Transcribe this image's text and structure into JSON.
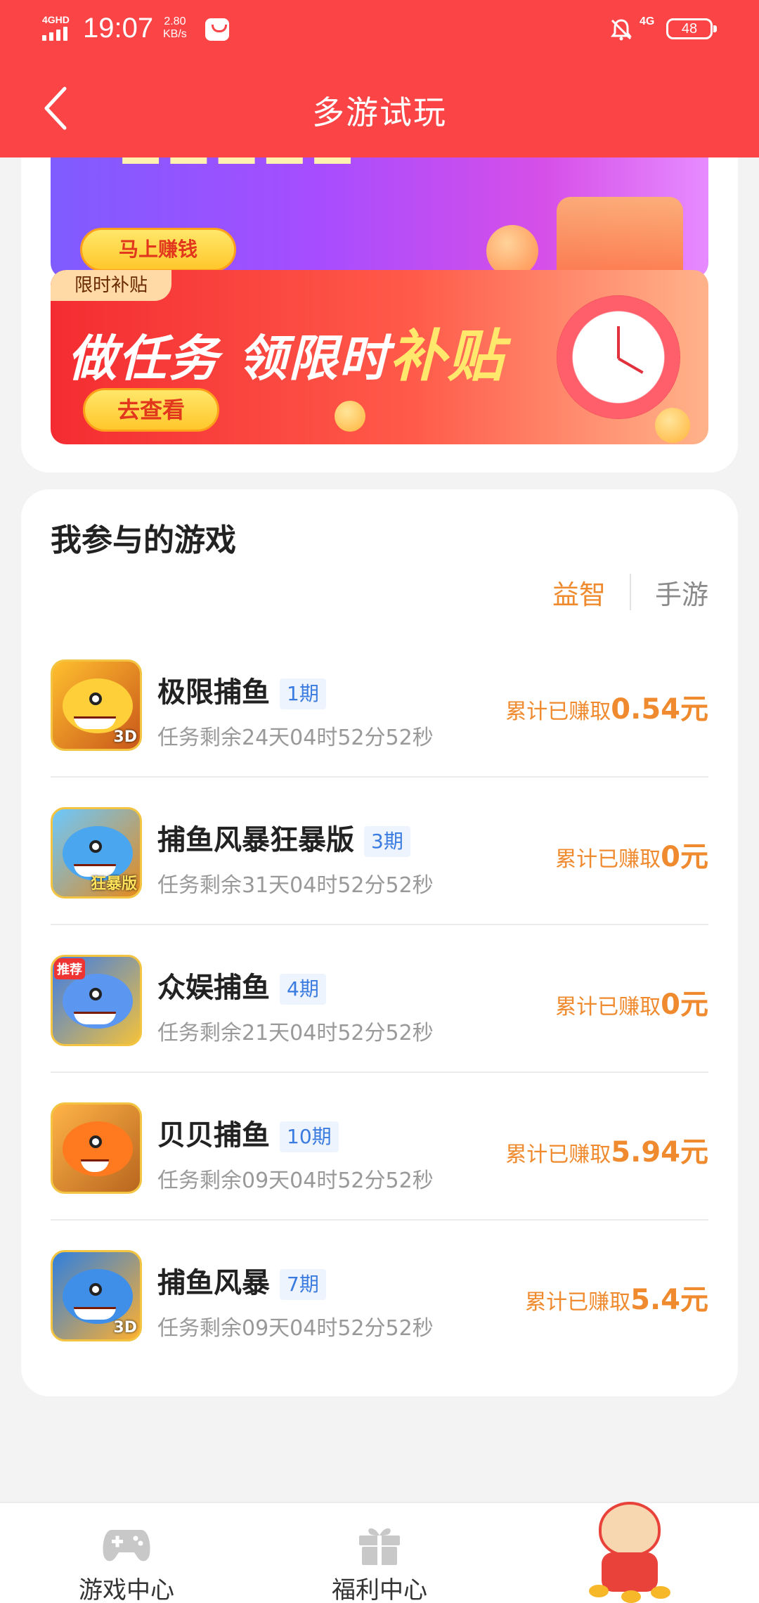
{
  "status_bar": {
    "network_label": "4GHD",
    "time": "19:07",
    "speed_value": "2.80",
    "speed_unit": "KB/s",
    "network_type": "4G",
    "battery": "48"
  },
  "header": {
    "title": "多游试玩",
    "background": "#fb4446"
  },
  "banners": {
    "banner1": {
      "button": "马上赚钱"
    },
    "banner2": {
      "tag": "限时补贴",
      "heading_part1": "做任务 领限时",
      "heading_part2": "补贴",
      "button": "去查看"
    }
  },
  "games_section": {
    "title": "我参与的游戏",
    "tabs": [
      {
        "label": "益智",
        "active": true
      },
      {
        "label": "手游",
        "active": false
      }
    ],
    "accent_color": "#ef8a2e",
    "games": [
      {
        "name": "极限捕鱼",
        "period": "1期",
        "remaining": "任务剩余24天04时52分52秒",
        "earned_label": "累计已赚取",
        "earned_amount": "0.54元",
        "icon": "gold-shark-3d-icon"
      },
      {
        "name": "捕鱼风暴狂暴版",
        "period": "3期",
        "remaining": "任务剩余31天04时52分52秒",
        "earned_label": "累计已赚取",
        "earned_amount": "0元",
        "icon": "blue-shark-rampage-icon"
      },
      {
        "name": "众娱捕鱼",
        "period": "4期",
        "remaining": "任务剩余21天04时52分52秒",
        "earned_label": "累计已赚取",
        "earned_amount": "0元",
        "icon": "recommended-shark-icon"
      },
      {
        "name": "贝贝捕鱼",
        "period": "10期",
        "remaining": "任务剩余09天04时52分52秒",
        "earned_label": "累计已赚取",
        "earned_amount": "5.94元",
        "icon": "clownfish-icon"
      },
      {
        "name": "捕鱼风暴",
        "period": "7期",
        "remaining": "任务剩余09天04时52分52秒",
        "earned_label": "累计已赚取",
        "earned_amount": "5.4元",
        "icon": "shark-3d-icon"
      }
    ]
  },
  "bottom_nav": {
    "items": [
      {
        "label": "游戏中心",
        "icon": "gamepad-icon"
      },
      {
        "label": "福利中心",
        "icon": "gift-icon"
      },
      {
        "label": "",
        "icon": "tiger-mascot-icon"
      }
    ]
  }
}
